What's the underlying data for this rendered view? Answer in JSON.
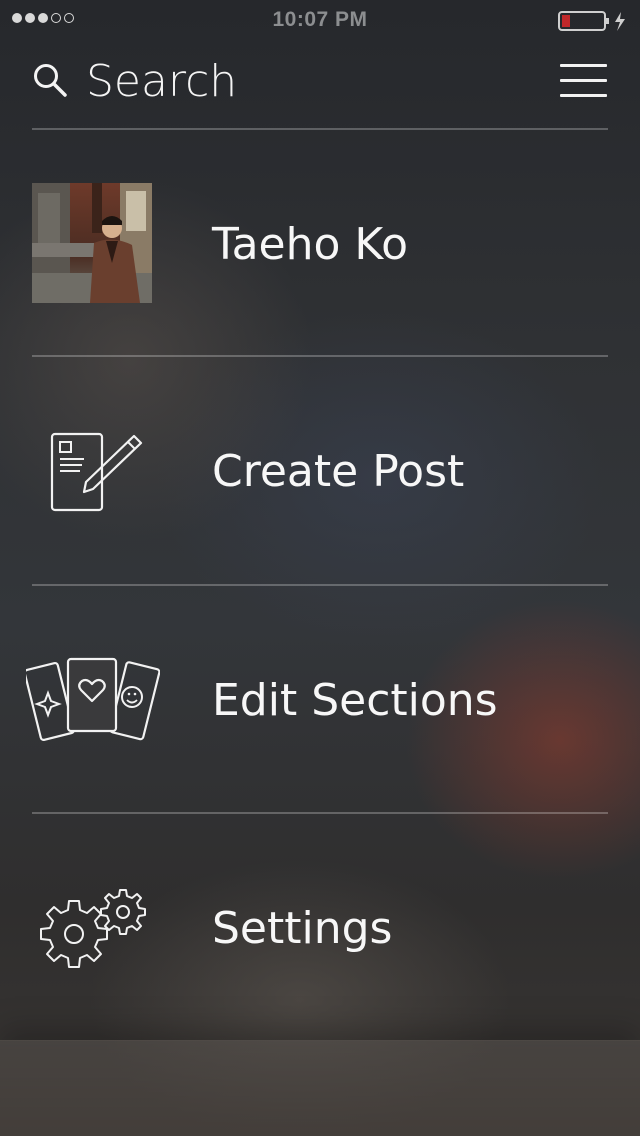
{
  "status_bar": {
    "time": "10:07 PM",
    "signal_dots_filled": 3,
    "signal_dots_total": 5,
    "battery_level": 0.2
  },
  "header": {
    "search_label": "Search",
    "search_icon": "search-icon",
    "menu_icon": "hamburger-menu-icon"
  },
  "menu": {
    "profile": {
      "label": "Taeho Ko"
    },
    "create_post": {
      "label": "Create Post",
      "icon": "create-post-icon"
    },
    "edit_sections": {
      "label": "Edit Sections",
      "icon": "cards-icon"
    },
    "settings": {
      "label": "Settings",
      "icon": "gears-icon"
    }
  },
  "colors": {
    "battery_low": "#c0282a",
    "text": "#ffffff",
    "divider": "rgba(255,255,255,0.25)"
  }
}
